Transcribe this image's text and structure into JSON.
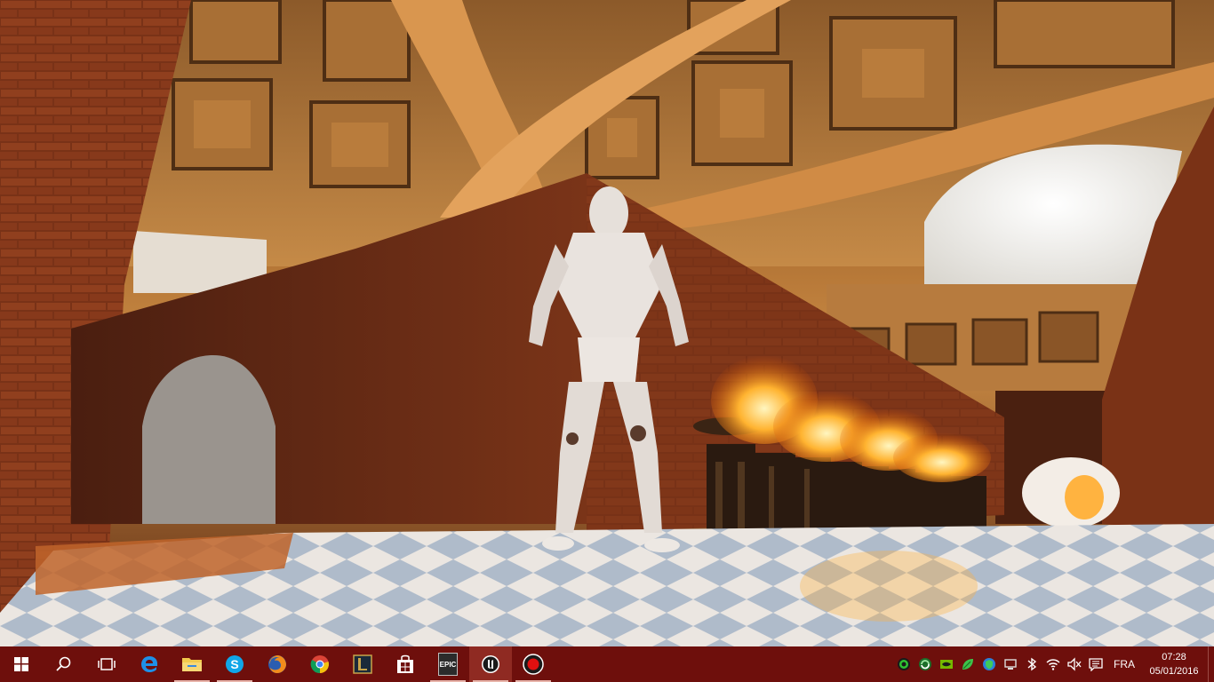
{
  "taskbar": {
    "pinned": [
      {
        "name": "start-button",
        "icon": "windows-logo-icon",
        "running": false,
        "active": false
      },
      {
        "name": "search-button",
        "icon": "search-icon",
        "running": false,
        "active": false
      },
      {
        "name": "task-view-button",
        "icon": "task-view-icon",
        "running": false,
        "active": false
      },
      {
        "name": "edge-button",
        "icon": "edge-icon",
        "running": false,
        "active": false
      },
      {
        "name": "file-explorer-button",
        "icon": "folder-icon",
        "running": true,
        "active": false
      },
      {
        "name": "skype-button",
        "icon": "skype-icon",
        "running": true,
        "active": false
      },
      {
        "name": "firefox-button",
        "icon": "firefox-icon",
        "running": false,
        "active": false
      },
      {
        "name": "chrome-button",
        "icon": "chrome-icon",
        "running": false,
        "active": false
      },
      {
        "name": "league-of-legends-button",
        "icon": "league-of-legends-icon",
        "running": false,
        "active": false
      },
      {
        "name": "store-button",
        "icon": "store-icon",
        "running": false,
        "active": false
      },
      {
        "name": "epic-games-launcher-button",
        "icon": "epic-games-icon",
        "running": true,
        "active": false
      },
      {
        "name": "unreal-engine-button",
        "icon": "unreal-engine-icon",
        "running": true,
        "active": true
      },
      {
        "name": "recorder-button",
        "icon": "record-icon",
        "running": true,
        "active": false
      }
    ],
    "epic_label": "EPIC",
    "tray": {
      "icons": [
        "razer-icon",
        "sync-icon",
        "nvidia-icon",
        "leaf-icon",
        "shield-icon",
        "network-device-icon",
        "bluetooth-icon",
        "wifi-icon",
        "volume-muted-icon",
        "notification-icon"
      ],
      "language": "FRA",
      "time": "07:28",
      "date": "05/01/2016"
    },
    "colors": {
      "background": "#6e0f0c",
      "active": "#8f2a22"
    }
  }
}
